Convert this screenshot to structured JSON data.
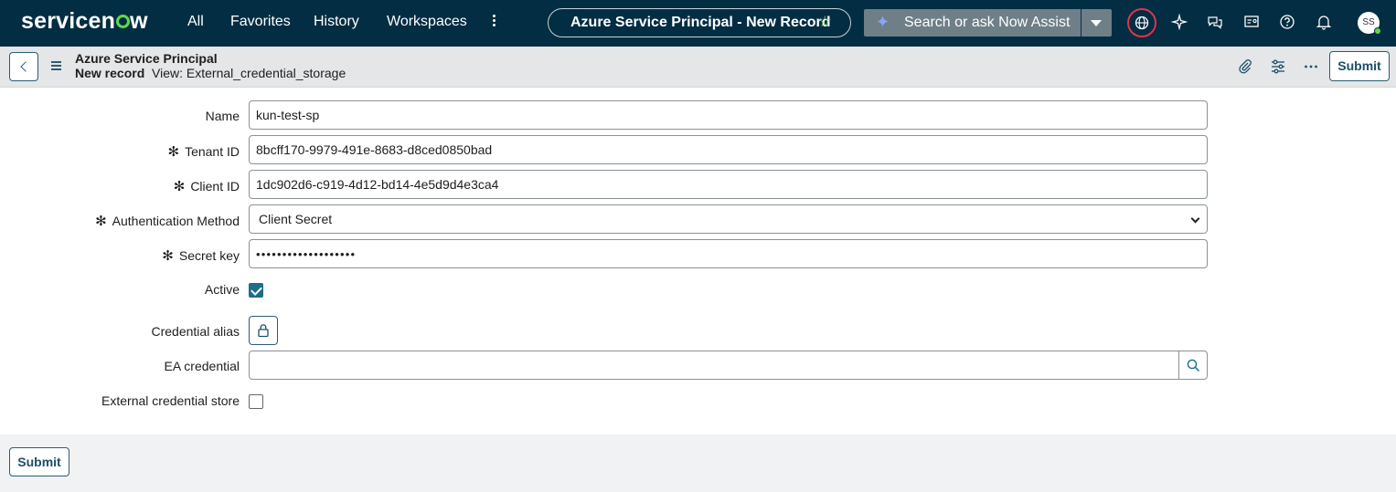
{
  "brand": {
    "logo_text_pre": "servicen",
    "logo_text_post": "w",
    "accent": "#62d84e",
    "nav_bg": "#032d42"
  },
  "nav": {
    "items": [
      "All",
      "Favorites",
      "History",
      "Workspaces"
    ]
  },
  "record_pill": {
    "title": "Azure Service Principal - New Record"
  },
  "search": {
    "placeholder": "Search or ask Now Assist"
  },
  "user": {
    "initials": "SS"
  },
  "header": {
    "table_title": "Azure Service Principal",
    "record_state": "New record",
    "view_label": "View: External_credential_storage",
    "submit_label": "Submit"
  },
  "form": {
    "name": {
      "label": "Name",
      "value": "kun-test-sp"
    },
    "tenant_id": {
      "label": "Tenant ID",
      "value": "8bcff170-9979-491e-8683-d8ced0850bad",
      "required_mark": "✻"
    },
    "client_id": {
      "label": "Client ID",
      "value": "1dc902d6-c919-4d12-bd14-4e5d9d4e3ca4",
      "required_mark": "✻"
    },
    "auth_method": {
      "label": "Authentication Method",
      "value": "Client Secret",
      "required_mark": "✻"
    },
    "secret_key": {
      "label": "Secret key",
      "value": "•••••••••••••••••••",
      "required_mark": "✻"
    },
    "active": {
      "label": "Active",
      "checked": true
    },
    "credential_alias": {
      "label": "Credential alias"
    },
    "ea_credential": {
      "label": "EA credential",
      "value": ""
    },
    "external_store": {
      "label": "External credential store",
      "checked": false
    }
  },
  "footer": {
    "submit_label": "Submit"
  }
}
